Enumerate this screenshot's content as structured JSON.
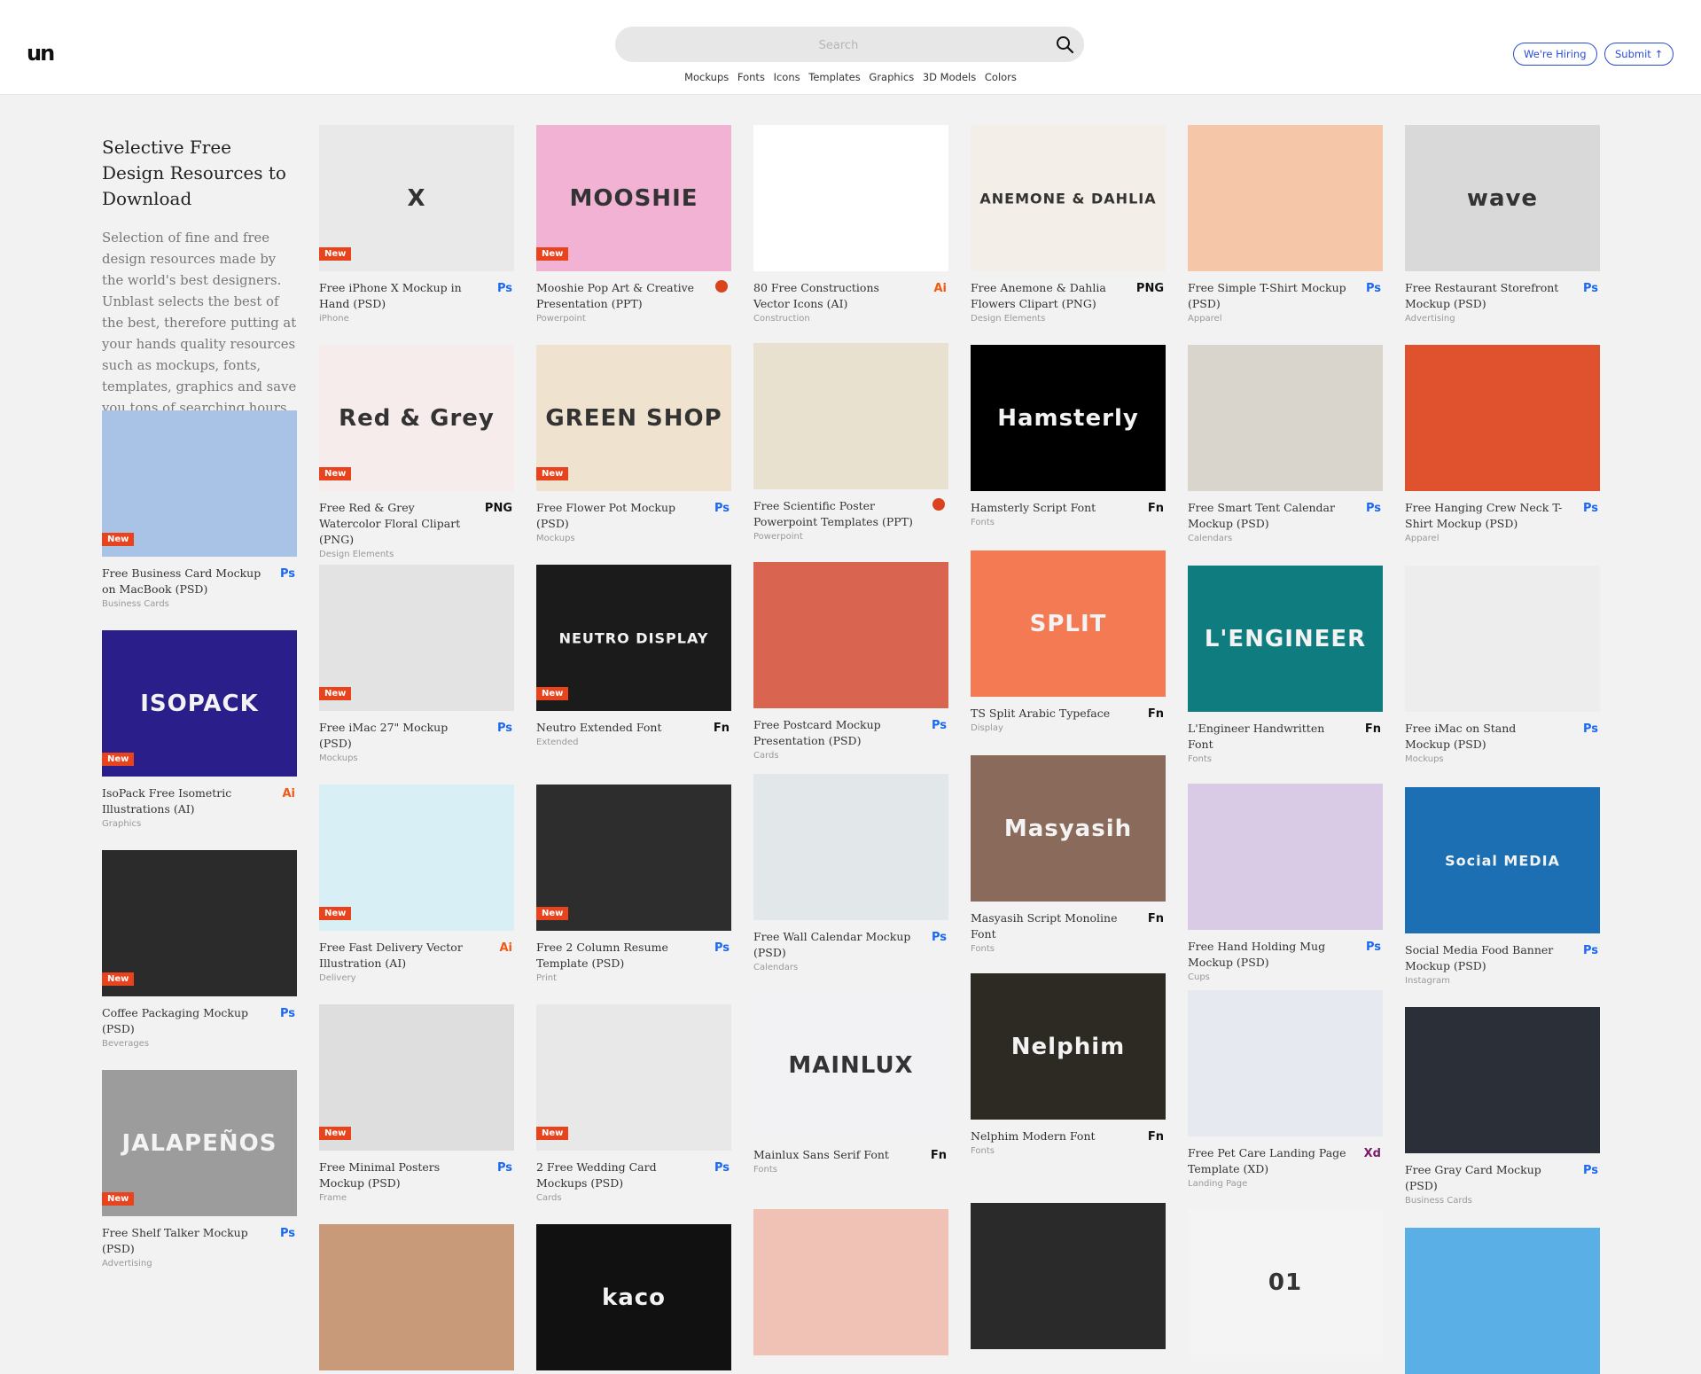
{
  "header": {
    "logo": "un",
    "search_placeholder": "Search",
    "nav": [
      "Mockups",
      "Fonts",
      "Icons",
      "Templates",
      "Graphics",
      "3D Models",
      "Colors"
    ],
    "hiring_label": "We're Hiring",
    "submit_label": "Submit ↑"
  },
  "intro": {
    "heading": "Selective Free Design Resources to Download",
    "body": "Selection of fine and free design resources made by the world's best designers. Unblast selects the best of the best, therefore putting at your hands quality resources such as mockups, fonts, templates, graphics and save you tons of searching hours."
  },
  "new_label": "New",
  "columns": [
    [
      {
        "title": "Free Business Card Mockup on MacBook (PSD)",
        "category": "Business Cards",
        "format": "Ps",
        "new": true,
        "bg": "#a9c3e6",
        "thumb_text": ""
      },
      {
        "title": "IsoPack Free Isometric Illustrations (AI)",
        "category": "Graphics",
        "format": "Ai",
        "new": true,
        "bg": "#2a1f8a",
        "thumb_text": "ISOPACK"
      },
      {
        "title": "Coffee Packaging Mockup (PSD)",
        "category": "Beverages",
        "format": "Ps",
        "new": true,
        "bg": "#2b2b2b",
        "thumb_text": ""
      },
      {
        "title": "Free Shelf Talker Mockup (PSD)",
        "category": "Advertising",
        "format": "Ps",
        "new": true,
        "bg": "#9c9c9c",
        "thumb_text": "JALAPEÑOS"
      }
    ],
    [
      {
        "title": "Free iPhone X Mockup in Hand (PSD)",
        "category": "iPhone",
        "format": "Ps",
        "new": true,
        "bg": "#e9e9e9",
        "thumb_text": "X"
      },
      {
        "title": "Free Red & Grey Watercolor Floral Clipart (PNG)",
        "category": "Design Elements",
        "format": "PNG",
        "new": true,
        "bg": "#f7ecec",
        "thumb_text": "Red & Grey"
      },
      {
        "title": "Free iMac 27\" Mockup (PSD)",
        "category": "Mockups",
        "format": "Ps",
        "new": true,
        "bg": "#e3e3e3",
        "thumb_text": ""
      },
      {
        "title": "Free Fast Delivery Vector Illustration (AI)",
        "category": "Delivery",
        "format": "Ai",
        "new": true,
        "bg": "#d8f0f5",
        "thumb_text": ""
      },
      {
        "title": "Free Minimal Posters Mockup (PSD)",
        "category": "Frame",
        "format": "Ps",
        "new": true,
        "bg": "#dedede",
        "thumb_text": ""
      },
      {
        "title": "",
        "category": "",
        "format": "",
        "new": false,
        "bg": "#c89a7a",
        "thumb_text": ""
      }
    ],
    [
      {
        "title": "Mooshie Pop Art & Creative Presentation (PPT)",
        "category": "Powerpoint",
        "format": "ppt",
        "new": true,
        "bg": "#f1b2d4",
        "thumb_text": "MOOSHIE"
      },
      {
        "title": "Free Flower Pot Mockup (PSD)",
        "category": "Mockups",
        "format": "Ps",
        "new": true,
        "bg": "#efe3cf",
        "thumb_text": "GREEN SHOP"
      },
      {
        "title": "Neutro Extended Font",
        "category": "Extended",
        "format": "Fn",
        "new": true,
        "bg": "#1b1b1b",
        "thumb_text": "NEUTRO DISPLAY"
      },
      {
        "title": "Free 2 Column Resume Template (PSD)",
        "category": "Print",
        "format": "Ps",
        "new": true,
        "bg": "#2d2d2d",
        "thumb_text": ""
      },
      {
        "title": "2 Free Wedding Card Mockups (PSD)",
        "category": "Cards",
        "format": "Ps",
        "new": true,
        "bg": "#e8e8e8",
        "thumb_text": ""
      },
      {
        "title": "",
        "category": "",
        "format": "",
        "new": false,
        "bg": "#111111",
        "thumb_text": "kaco"
      }
    ],
    [
      {
        "title": "80 Free Constructions Vector Icons (AI)",
        "category": "Construction",
        "format": "Ai",
        "new": false,
        "bg": "#ffffff",
        "thumb_text": ""
      },
      {
        "title": "Free Scientific Poster Powerpoint Templates (PPT)",
        "category": "Powerpoint",
        "format": "ppt",
        "new": false,
        "bg": "#e9e1cf",
        "thumb_text": ""
      },
      {
        "title": "Free Postcard Mockup Presentation (PSD)",
        "category": "Cards",
        "format": "Ps",
        "new": false,
        "bg": "#d9644f",
        "thumb_text": ""
      },
      {
        "title": "Free Wall Calendar Mockup (PSD)",
        "category": "Calendars",
        "format": "Ps",
        "new": false,
        "bg": "#e2e7ea",
        "thumb_text": ""
      },
      {
        "title": "Mainlux Sans Serif Font",
        "category": "Fonts",
        "format": "Fn",
        "new": false,
        "bg": "#f2f2f4",
        "thumb_text": "MAINLUX"
      },
      {
        "title": "",
        "category": "",
        "format": "",
        "new": false,
        "bg": "#f0c2b5",
        "thumb_text": ""
      }
    ],
    [
      {
        "title": "Free Anemone & Dahlia Flowers Clipart (PNG)",
        "category": "Design Elements",
        "format": "PNG",
        "new": false,
        "bg": "#f3eee8",
        "thumb_text": "ANEMONE & DAHLIA"
      },
      {
        "title": "Hamsterly Script Font",
        "category": "Fonts",
        "format": "Fn",
        "new": false,
        "bg": "#000000",
        "thumb_text": "Hamsterly"
      },
      {
        "title": "TS Split Arabic Typeface",
        "category": "Display",
        "format": "Fn",
        "new": false,
        "bg": "#f47a54",
        "thumb_text": "SPLIT"
      },
      {
        "title": "Masyasih Script Monoline Font",
        "category": "Fonts",
        "format": "Fn",
        "new": false,
        "bg": "#8a6a5a",
        "thumb_text": "Masyasih"
      },
      {
        "title": "Nelphim Modern Font",
        "category": "Fonts",
        "format": "Fn",
        "new": false,
        "bg": "#2c2a22",
        "thumb_text": "Nelphim"
      },
      {
        "title": "",
        "category": "",
        "format": "",
        "new": false,
        "bg": "#2a2a2a",
        "thumb_text": ""
      }
    ],
    [
      {
        "title": "Free Simple T-Shirt Mockup (PSD)",
        "category": "Apparel",
        "format": "Ps",
        "new": false,
        "bg": "#f6c6a8",
        "thumb_text": ""
      },
      {
        "title": "Free Smart Tent Calendar Mockup (PSD)",
        "category": "Calendars",
        "format": "Ps",
        "new": false,
        "bg": "#d9d5cc",
        "thumb_text": ""
      },
      {
        "title": "L'Engineer Handwritten Font",
        "category": "Fonts",
        "format": "Fn",
        "new": false,
        "bg": "#0f7d80",
        "thumb_text": "L'ENGINEER"
      },
      {
        "title": "Free Hand Holding Mug Mockup (PSD)",
        "category": "Cups",
        "format": "Ps",
        "new": false,
        "bg": "#d9cbe6",
        "thumb_text": ""
      },
      {
        "title": "Free Pet Care Landing Page Template (XD)",
        "category": "Landing Page",
        "format": "Xd",
        "new": false,
        "bg": "#e6e9f0",
        "thumb_text": ""
      },
      {
        "title": "",
        "category": "",
        "format": "",
        "new": false,
        "bg": "#f4f4f4",
        "thumb_text": "01"
      }
    ],
    [
      {
        "title": "Free Restaurant Storefront Mockup (PSD)",
        "category": "Advertising",
        "format": "Ps",
        "new": false,
        "bg": "#d9d9d9",
        "thumb_text": "wave"
      },
      {
        "title": "Free Hanging Crew Neck T-Shirt Mockup (PSD)",
        "category": "Apparel",
        "format": "Ps",
        "new": false,
        "bg": "#e0522e",
        "thumb_text": ""
      },
      {
        "title": "Free iMac on Stand Mockup (PSD)",
        "category": "Mockups",
        "format": "Ps",
        "new": false,
        "bg": "#ededed",
        "thumb_text": ""
      },
      {
        "title": "Social Media Food Banner Mockup (PSD)",
        "category": "Instagram",
        "format": "Ps",
        "new": false,
        "bg": "#1b6fb2",
        "thumb_text": "Social MEDIA"
      },
      {
        "title": "Free Gray Card Mockup (PSD)",
        "category": "Business Cards",
        "format": "Ps",
        "new": false,
        "bg": "#2b3038",
        "thumb_text": ""
      },
      {
        "title": "",
        "category": "",
        "format": "",
        "new": false,
        "bg": "#5ab0e6",
        "thumb_text": ""
      }
    ]
  ]
}
